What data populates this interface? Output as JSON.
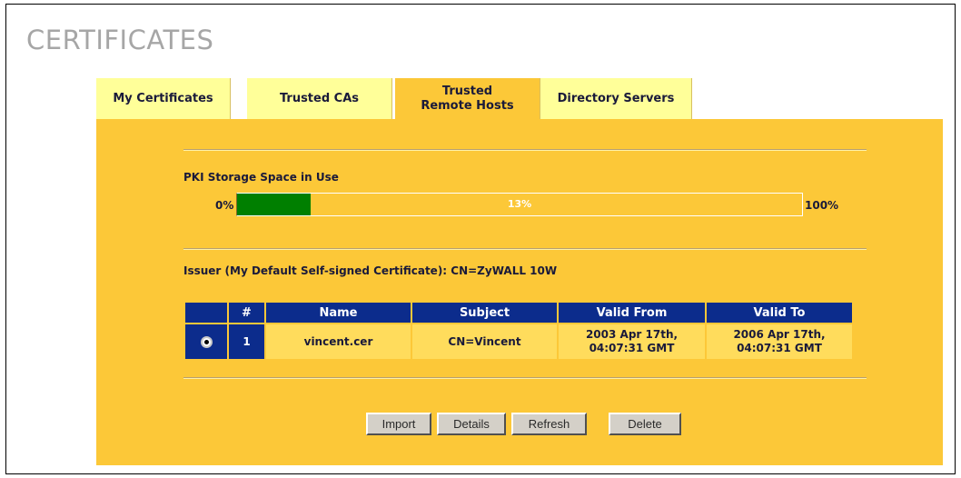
{
  "page": {
    "title": "CERTIFICATES"
  },
  "tabs": [
    {
      "label": "My Certificates",
      "active": false
    },
    {
      "label": "Trusted CAs",
      "active": false
    },
    {
      "label": "Trusted Remote Hosts",
      "active": true
    },
    {
      "label": "Directory Servers",
      "active": false
    }
  ],
  "storage": {
    "label": "PKI Storage Space in Use",
    "min_label": "0%",
    "max_label": "100%",
    "percent_text": "13%",
    "used_fraction": 0.13,
    "fill_color": "#007f00"
  },
  "issuer": {
    "text": "Issuer (My Default Self-signed Certificate): CN=ZyWALL 10W"
  },
  "table": {
    "columns": [
      "",
      "#",
      "Name",
      "Subject",
      "Valid From",
      "Valid To"
    ],
    "rows": [
      {
        "selected": true,
        "index": "1",
        "name": "vincent.cer",
        "subject": "CN=Vincent",
        "valid_from": "2003 Apr 17th, 04:07:31 GMT",
        "valid_to": "2006 Apr 17th, 04:07:31 GMT"
      }
    ]
  },
  "buttons": {
    "import": "Import",
    "details": "Details",
    "refresh": "Refresh",
    "delete": "Delete"
  },
  "colors": {
    "panel": "#fcc838",
    "tab_inactive": "#ffff99",
    "header": "#0c2c8c",
    "cell": "#ffdc5c"
  }
}
